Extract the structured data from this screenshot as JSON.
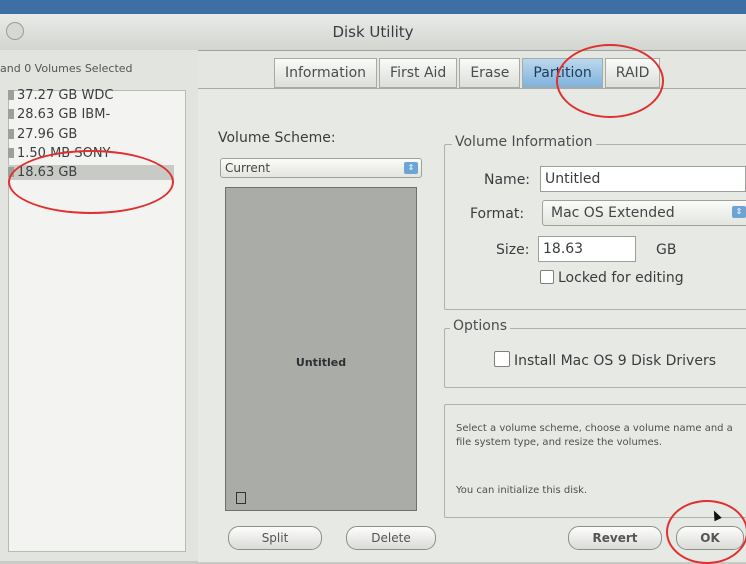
{
  "window": {
    "title": "Disk Utility"
  },
  "sidebar": {
    "header": "and 0 Volumes Selected",
    "items": [
      {
        "label": "37.27 GB WDC"
      },
      {
        "label": "28.63 GB IBM-"
      },
      {
        "label": "27.96 GB"
      },
      {
        "label": "1.50 MB SONY"
      },
      {
        "label": "18.63 GB"
      }
    ]
  },
  "tabs": [
    {
      "label": "Information"
    },
    {
      "label": "First Aid"
    },
    {
      "label": "Erase"
    },
    {
      "label": "Partition"
    },
    {
      "label": "RAID"
    }
  ],
  "volume_scheme": {
    "label": "Volume Scheme:",
    "selected": "Current",
    "partition_name": "Untitled"
  },
  "volume_info": {
    "title": "Volume Information",
    "name_label": "Name:",
    "name_value": "Untitled",
    "format_label": "Format:",
    "format_value": "Mac OS Extended",
    "size_label": "Size:",
    "size_value": "18.63",
    "size_unit": "GB",
    "locked_label": "Locked for editing"
  },
  "options": {
    "title": "Options",
    "install_drivers_label": "Install Mac OS 9 Disk Drivers"
  },
  "help": {
    "line1": "Select a volume scheme, choose a volume name and a file system type, and resize the volumes.",
    "line2": "You can initialize this disk."
  },
  "buttons": {
    "split": "Split",
    "delete": "Delete",
    "revert": "Revert",
    "ok": "OK"
  },
  "colors": {
    "annotation_circle": "#e03030",
    "active_tab": "#7fb2dc"
  }
}
